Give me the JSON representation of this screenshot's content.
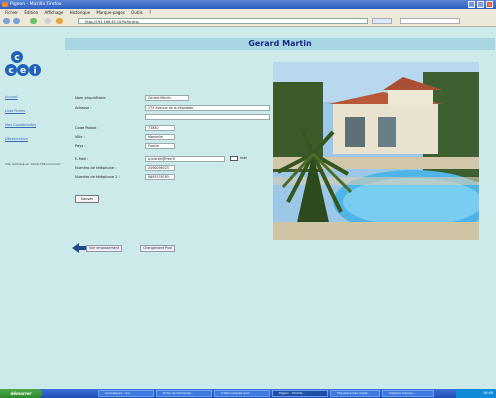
{
  "window": {
    "title": "Pigeon - Mozilla Firefox"
  },
  "menu": [
    "Fichier",
    "Édition",
    "Affichage",
    "Historique",
    "Marque-pages",
    "Outils",
    "?"
  ],
  "address": {
    "url": "http://192.168.45.10/fiche.php"
  },
  "header": {
    "name": "Gerard Martin"
  },
  "sidebar": {
    "links": [
      "Accueil",
      "Liste Fiches",
      "Mes Coordonnées",
      "Déconnexion"
    ],
    "note": "Site optimisé en 1024x768 minimum"
  },
  "form": {
    "fields": [
      {
        "label": "Nom propriétaire",
        "value": "Gerard Martin"
      },
      {
        "label": "Adresse :",
        "value": "275 avenue de la cépolette"
      },
      {
        "label": "",
        "value": ""
      },
      {
        "label": "Code Postal :",
        "value": "73830"
      },
      {
        "label": "Ville :",
        "value": "Marseille"
      },
      {
        "label": "Pays :",
        "value": "France"
      },
      {
        "label": "E-Mail :",
        "value": "g.martin@free.fr"
      },
      {
        "label": "Numéro de téléphone :",
        "value": "0490096325"
      },
      {
        "label": "Numéro de téléphone 2 :",
        "value": "0695576785"
      }
    ],
    "mail_label": "mail",
    "save_label": "Sauver"
  },
  "bottom": {
    "btn1": "Voir emplacement",
    "btn2": "Changement Pool"
  },
  "taskbar": {
    "start": "démarrer",
    "tasks": [
      "Animateurs - Go...",
      "Fiche de demande...",
      "C:\\Documents and...",
      "Pigeon - Mozilla...",
      "The place has made...",
      "Capture d'écran..."
    ],
    "clock": "16:48"
  },
  "colors": {
    "page_bg": "#cdeaea",
    "header_bg": "#a9d6e3",
    "title_text": "#1b2a8c",
    "link": "#3a68b8"
  }
}
